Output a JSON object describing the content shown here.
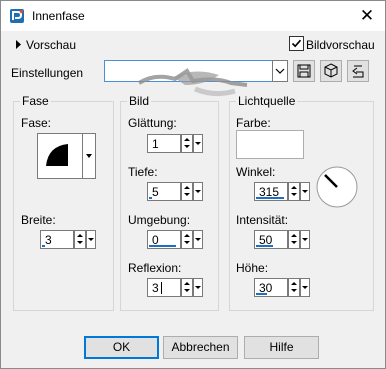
{
  "window": {
    "title": "Innenfase"
  },
  "preview": {
    "label": "Vorschau",
    "bildvorschau_label": "Bildvorschau",
    "bildvorschau_checked": true
  },
  "settings": {
    "label": "Einstellungen",
    "value": ""
  },
  "fase": {
    "group_title": "Fase",
    "shape_label": "Fase:",
    "width_label": "Breite:",
    "width_value": "3"
  },
  "bild": {
    "group_title": "Bild",
    "smoothing_label": "Glättung:",
    "smoothing_value": "1",
    "depth_label": "Tiefe:",
    "depth_value": "5",
    "ambience_label": "Umgebung:",
    "ambience_value": "0",
    "reflection_label": "Reflexion:",
    "reflection_value": "3"
  },
  "light": {
    "group_title": "Lichtquelle",
    "color_label": "Farbe:",
    "color_value": "#ffffff",
    "angle_label": "Winkel:",
    "angle_value": "315",
    "intensity_label": "Intensität:",
    "intensity_value": "50",
    "elevation_label": "Höhe:",
    "elevation_value": "30"
  },
  "buttons": {
    "ok": "OK",
    "cancel": "Abbrechen",
    "help": "Hilfe"
  },
  "colors": {
    "accent": "#1e6fc3",
    "primary_border": "#0078d7"
  }
}
